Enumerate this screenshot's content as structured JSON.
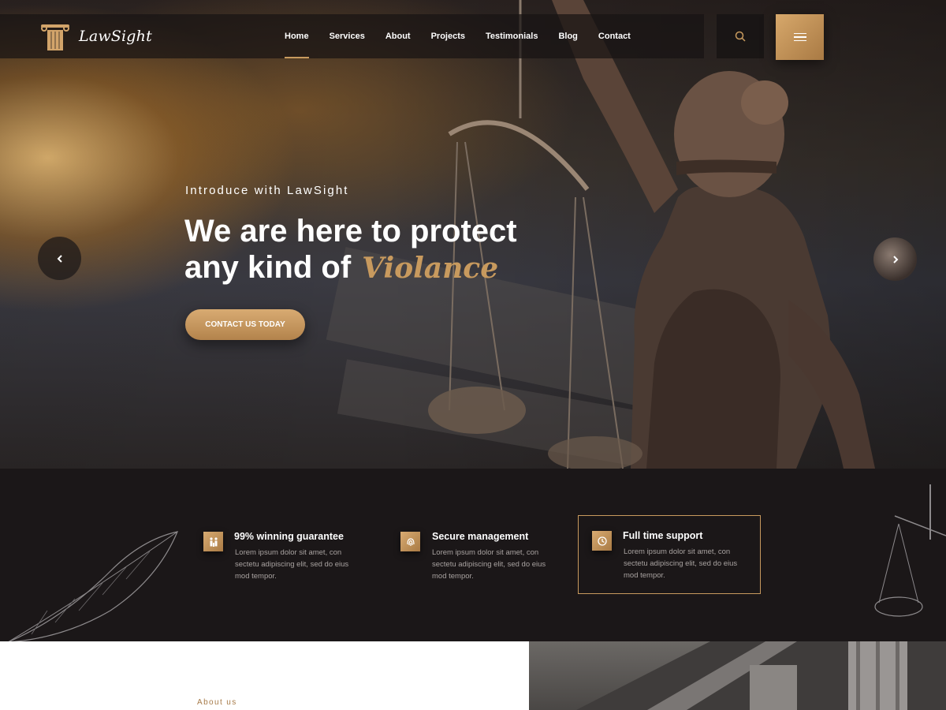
{
  "brand": {
    "name": "LawSight"
  },
  "nav": {
    "items": [
      {
        "label": "Home",
        "active": true
      },
      {
        "label": "Services"
      },
      {
        "label": "About"
      },
      {
        "label": "Projects"
      },
      {
        "label": "Testimonials"
      },
      {
        "label": "Blog"
      },
      {
        "label": "Contact"
      }
    ]
  },
  "hero": {
    "kicker": "Introduce with LawSight",
    "headline_line1": "We are here to protect",
    "headline_line2": "any kind of",
    "headline_accent": "Violance",
    "cta_label": "CONTACT US TODAY"
  },
  "features": [
    {
      "title": "99% winning guarantee",
      "text": "Lorem ipsum dolor sit amet, con sectetu adipiscing elit, sed do eius mod tempor.",
      "icon": "family-icon"
    },
    {
      "title": "Secure management",
      "text": "Lorem ipsum dolor sit amet, con sectetu adipiscing elit, sed do eius mod tempor.",
      "icon": "fingerprint-icon"
    },
    {
      "title": "Full time support",
      "text": "Lorem ipsum dolor sit amet, con sectetu adipiscing elit, sed do eius mod tempor.",
      "icon": "support-clock-icon"
    }
  ],
  "about": {
    "kicker": "About us"
  },
  "colors": {
    "accent": "#c89a5e",
    "dark": "#1b1718",
    "muted_text": "#a8a2a0"
  }
}
